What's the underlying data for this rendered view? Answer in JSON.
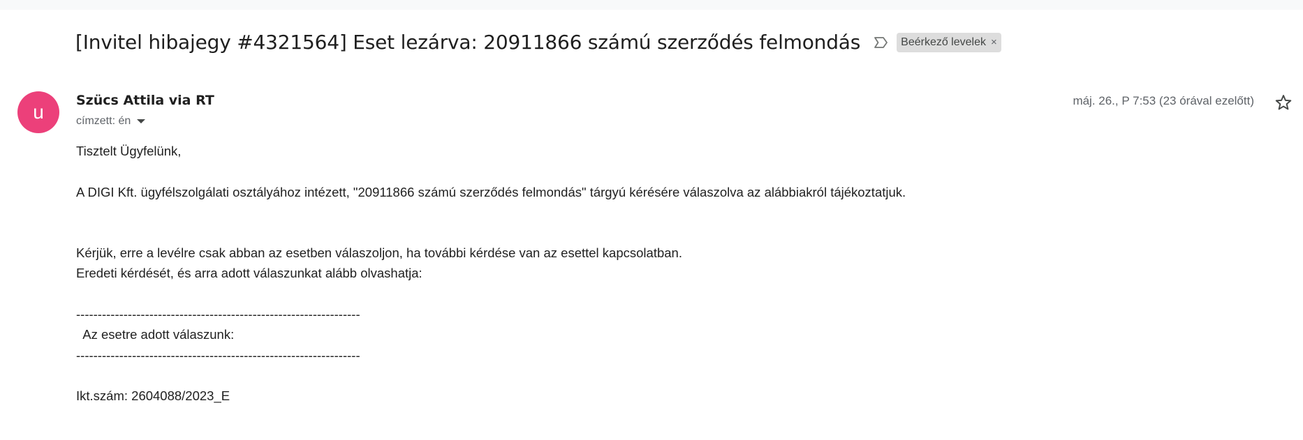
{
  "email": {
    "subject": "[Invitel hibajegy #4321564] Eset lezárva: 20911866 számú szerződés felmondás",
    "label_chip": "Beérkező levelek",
    "label_chip_close": "×",
    "avatar_initial": "u",
    "sender": "Szücs Attila via RT",
    "recipient": "címzett: én",
    "date": "máj. 26., P 7:53 (23 órával ezelőtt)",
    "body": {
      "greeting": "Tisztelt Ügyfelünk,",
      "line1": "A DIGI Kft. ügyfélszolgálati osztályához intézett, \"20911866 számú szerződés felmondás\" tárgyú kérésére válaszolva az alábbiakról tájékoztatjuk.",
      "line2": "Kérjük, erre a levélre csak abban az esetben válaszoljon, ha további kérdése van az esettel kapcsolatban.",
      "line3": "Eredeti kérdését, és arra adott válaszunkat alább olvashatja:",
      "separator": "------------------------------------------------------------------",
      "answer_heading": "  Az esetre adott válaszunk:",
      "reference": "Ikt.szám: 2604088/2023_E"
    }
  },
  "colors": {
    "avatar_bg": "#ec407a",
    "chip_bg": "#dddddd",
    "muted_text": "#5f6368"
  },
  "icons": {
    "importance": "label-importance-icon",
    "star": "star-icon",
    "recipient_details": "chevron-down-icon",
    "chip_remove": "close-icon"
  }
}
